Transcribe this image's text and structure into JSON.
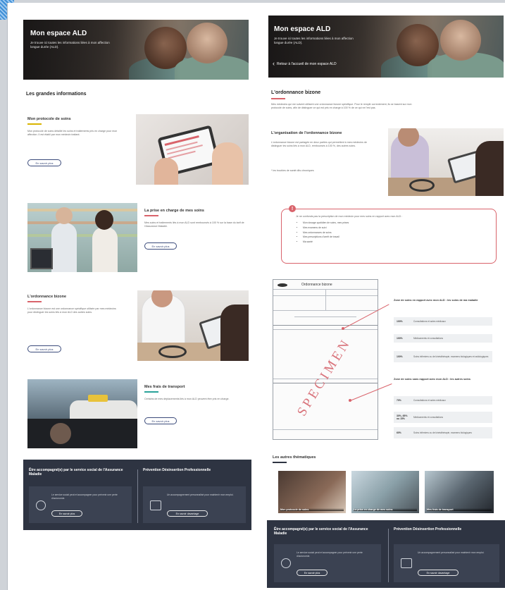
{
  "left": {
    "hero": {
      "title": "Mon espace ALD",
      "subtitle": "Je trouve ici toutes les informations liées à mon affection longue durée (ALD)."
    },
    "section_title": "Les grandes informations",
    "blocks": [
      {
        "title": "Mon protocole de soins",
        "accent": "#d9b400",
        "text": "Mon protocole de soins détaille les soins et traitements pris en charge pour mon affection. Il est établi par mon médecin traitant.",
        "button": "En savoir plus"
      },
      {
        "title": "La prise en charge de mes soins",
        "accent": "#d9636b",
        "text": "Mes soins et traitements liés à mon ALD sont remboursés à 100 % sur la base du tarif de l'Assurance Maladie.",
        "button": "En savoir plus"
      },
      {
        "title": "L'ordonnance bizone",
        "accent": "#d9636b",
        "text": "L'ordonnance bizone est une ordonnance spécifique utilisée par mes médecins pour distinguer les soins liés à mon ALD des autres soins.",
        "button": "En savoir plus"
      },
      {
        "title": "Mes frais de transport",
        "accent": "#2aa39a",
        "text": "Certains de mes déplacements liés à mon ALD peuvent être pris en charge.",
        "button": "En savoir plus"
      }
    ],
    "footer": {
      "col1_title": "Être accompagné(e) par le service social de l'Assurance Maladie",
      "col1_text": "Le service social peut m'accompagner pour prévenir une perte d'autonomie.",
      "col1_button": "En savoir plus",
      "col2_title": "Prévention Désinsertion Professionnelle",
      "col2_text": "Un accompagnement personnalisé pour maintenir mon emploi.",
      "col2_button": "En savoir davantage"
    }
  },
  "right": {
    "hero": {
      "title": "Mon espace ALD",
      "subtitle": "Je trouve ici toutes les informations liées à mon affection longue durée (ALD).",
      "back": "Retour à l'accueil de mon espace ALD"
    },
    "section_title": "L'ordonnance bizone",
    "intro": "Mes médecins qui me suivent utilisent une ordonnance bizone spécifique. Pour le remplir correctement, ils se basent sur mon protocole de soins, afin de distinguer ce qui est pris en charge à 100 % de ce qui ne l'est pas.",
    "org_title": "L'organisation de l'ordonnance bizone",
    "org_text": "L'ordonnance bizone est partagée en deux parties qui permettent à mes médecins de distinguer les soins liés à mon ALD, remboursés à 100 %, des autres soins.",
    "org_note": "* les troubles de santé dits chroniques",
    "alert_intro": "Je ne confonds pas la prescription de mon médecin pour mes soins en rapport avec mon ALD :",
    "alert_items": [
      "Mon dosage quotidien de soins, mes prises",
      "Mes examens de suivi",
      "Mes ordonnances de soins",
      "Mes prescriptions d'arrêt de travail",
      "Ma santé"
    ],
    "doc_title": "Ordonnance bizone",
    "specimen": "SPECIMEN",
    "legend_top": {
      "title": "Zone de soins en rapport avec mon ALD : les soins de ma maladie",
      "rows": [
        {
          "k": "100%",
          "v": "Consultations et actes médicaux"
        },
        {
          "k": "100%",
          "v": "Médicaments et consultations"
        },
        {
          "k": "100%",
          "v": "Soins infirmiers ou de kinésithérapie, examens biologiques et radiologiques"
        }
      ]
    },
    "legend_bottom": {
      "title": "Zone de soins sans rapport avec mon ALD : les autres soins",
      "rows": [
        {
          "k": "70%",
          "v": "Consultations et actes médicaux"
        },
        {
          "k": "30%, 65% ou 15%",
          "v": "Médicaments et consultations"
        },
        {
          "k": "60%",
          "v": "Soins infirmiers ou de kinésithérapie, examens biologiques"
        }
      ]
    },
    "others_title": "Les autres thématiques",
    "thumbs": [
      {
        "label": "Mon protocole de soins"
      },
      {
        "label": "La prise en charge de mes soins"
      },
      {
        "label": "Mes frais de transport"
      }
    ],
    "footer": {
      "col1_title": "Être accompagné(e) par le service social de l'Assurance Maladie",
      "col1_text": "Le service social peut m'accompagner pour prévenir une perte d'autonomie.",
      "col1_button": "En savoir plus",
      "col2_title": "Prévention Désinsertion Professionnelle",
      "col2_text": "Un accompagnement personnalisé pour maintenir mon emploi.",
      "col2_button": "En savoir davantage"
    }
  }
}
